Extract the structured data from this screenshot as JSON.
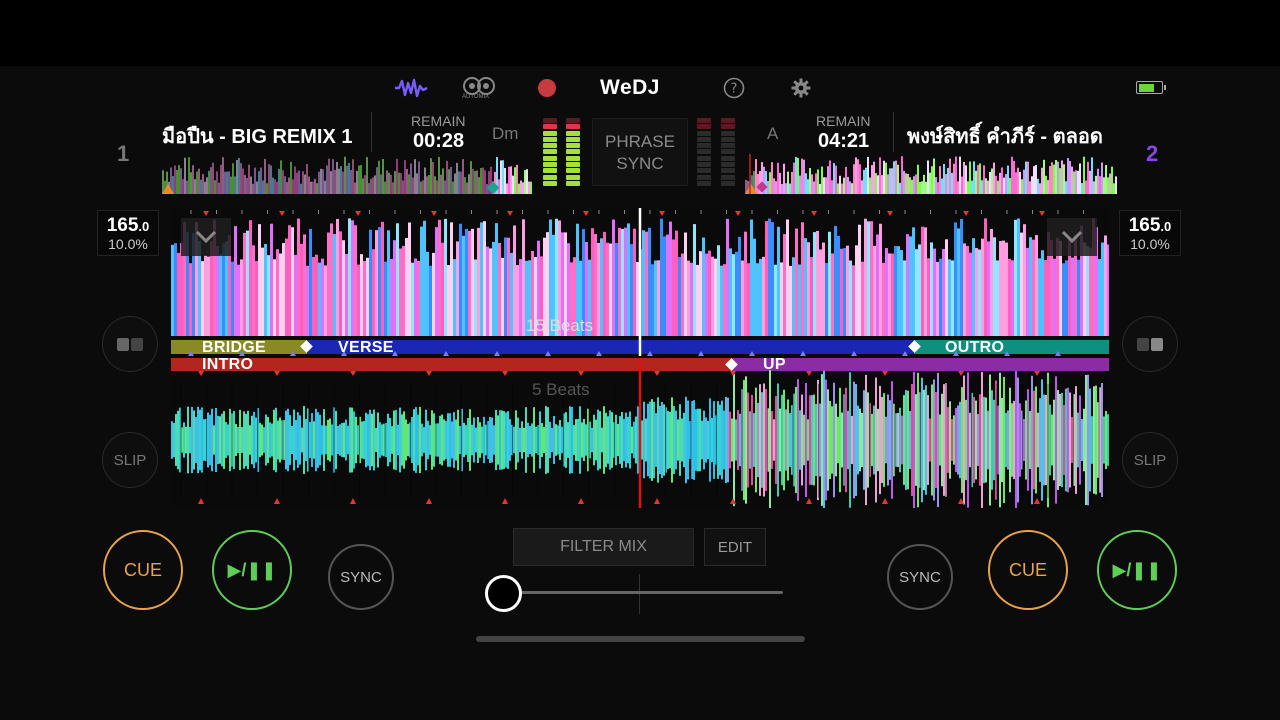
{
  "topbar": {
    "logo": "WeDJ",
    "automix_label": "AUTOMIX",
    "icons": [
      "waveform-icon",
      "automix-icon",
      "record-icon",
      "help-icon",
      "settings-icon",
      "battery-icon"
    ]
  },
  "deck1": {
    "number": "1",
    "title": "มือปืน - BIG REMIX 1",
    "remain_label": "REMAIN",
    "remain": "00:28",
    "key": "Dm",
    "bpm_int": "165",
    "bpm_dec": ".0",
    "pitch": "10.0%",
    "cue_label": "CUE",
    "play_label": "▶/❚❚",
    "sync_label": "SYNC",
    "slip_label": "SLIP",
    "beats_label": "15 Beats"
  },
  "deck2": {
    "number": "2",
    "title": "พงษ์สิทธิ์ คำภีร์ - ตลอด",
    "remain_label": "REMAIN",
    "remain": "04:21",
    "key": "A",
    "bpm_int": "165",
    "bpm_dec": ".0",
    "pitch": "10.0%",
    "cue_label": "CUE",
    "play_label": "▶/❚❚",
    "sync_label": "SYNC",
    "slip_label": "SLIP",
    "beats_label": "5 Beats"
  },
  "center": {
    "phrase_sync": "PHRASE SYNC",
    "filter_mix": "FILTER MIX",
    "edit": "EDIT"
  },
  "phrases_top": [
    "BRIDGE",
    "VERSE",
    "OUTRO"
  ],
  "phrases_bottom": [
    "INTRO",
    "UP"
  ],
  "colors": {
    "cue": "#e8a34a",
    "play": "#5fce58",
    "deck2_number": "#8b45e6",
    "record": "#c73a3f",
    "waveform_icon": "#7b5cff",
    "phrase_bridge": "#8a8a24",
    "phrase_verse": "#1a26b4",
    "phrase_outro": "#0f8f80",
    "phrase_intro": "#b3261e",
    "phrase_up": "#8b2ca5"
  }
}
